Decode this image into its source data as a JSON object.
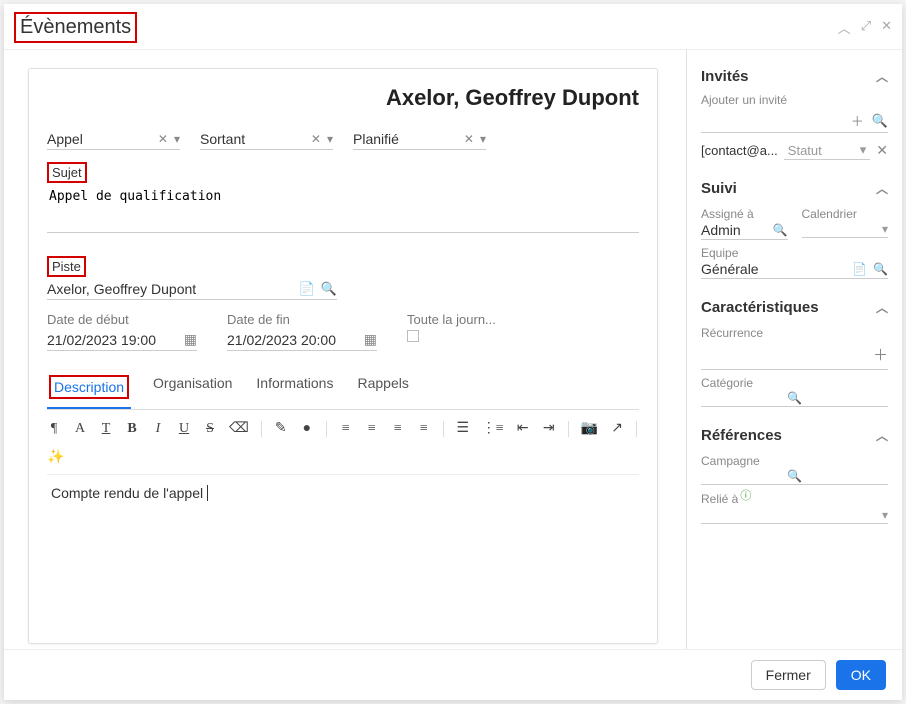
{
  "modal": {
    "title": "Évènements",
    "close_label": "Fermer",
    "ok_label": "OK"
  },
  "record": {
    "title": "Axelor, Geoffrey Dupont",
    "type_value": "Appel",
    "direction_value": "Sortant",
    "status_value": "Planifié",
    "subject_label": "Sujet",
    "subject_value": "Appel de qualification",
    "lead_label": "Piste",
    "lead_value": "Axelor, Geoffrey Dupont",
    "start_label": "Date de début",
    "start_value": "21/02/2023 19:00",
    "end_label": "Date de fin",
    "end_value": "21/02/2023 20:00",
    "allday_label": "Toute la journ..."
  },
  "tabs": {
    "description": "Description",
    "organisation": "Organisation",
    "informations": "Informations",
    "rappels": "Rappels"
  },
  "editor": {
    "content": "Compte rendu de l'appel"
  },
  "toolbar_icons": {
    "para": "¶",
    "font": "A",
    "textcolor": "T",
    "bold": "B",
    "italic": "I",
    "underline": "U",
    "strike": "S",
    "clear": "⌫",
    "brush": "✎",
    "drop": "●",
    "align_l": "≡",
    "align_c": "≡",
    "align_r": "≡",
    "align_j": "≡",
    "ol": "☰",
    "ul": "⋮≡",
    "indent": "⇥",
    "outdent": "⇤",
    "camera": "📷",
    "link": "↗",
    "magic": "✨"
  },
  "side": {
    "invites": {
      "title": "Invités",
      "hint": "Ajouter un invité",
      "contact_email": "[contact@a...",
      "status_label": "Statut"
    },
    "suivi": {
      "title": "Suivi",
      "assignee_label": "Assigné à",
      "assignee_value": "Admin",
      "calendar_label": "Calendrier",
      "team_label": "Equipe",
      "team_value": "Générale"
    },
    "caracteristiques": {
      "title": "Caractéristiques",
      "recurrence_label": "Récurrence",
      "category_label": "Catégorie"
    },
    "references": {
      "title": "Références",
      "campaign_label": "Campagne",
      "related_label": "Relié à"
    }
  }
}
